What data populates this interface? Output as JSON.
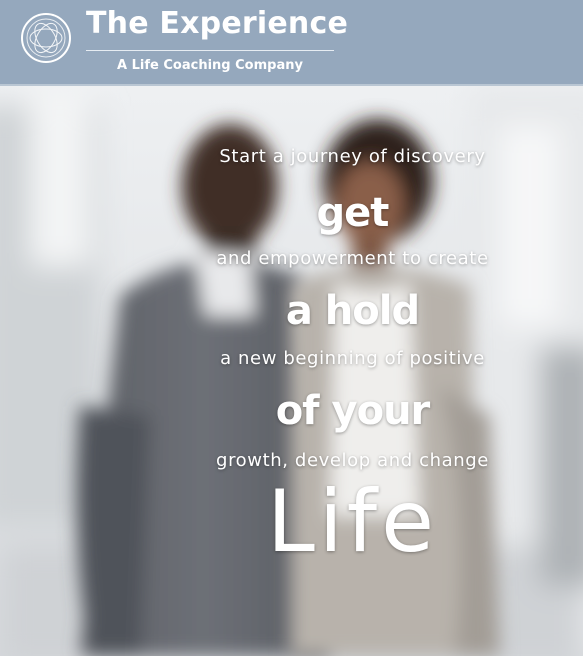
{
  "header": {
    "brand_title": "The Experience",
    "tagline": "A Life Coaching Company",
    "logo_icon": "circular-knot-logo-icon",
    "background_color": "#95a8bd"
  },
  "hero": {
    "lines": [
      "Start a journey of discovery",
      "get",
      "and empowerment to create",
      "a hold",
      "a new beginning of positive",
      "of your",
      "growth, develop and change",
      "Life"
    ]
  }
}
